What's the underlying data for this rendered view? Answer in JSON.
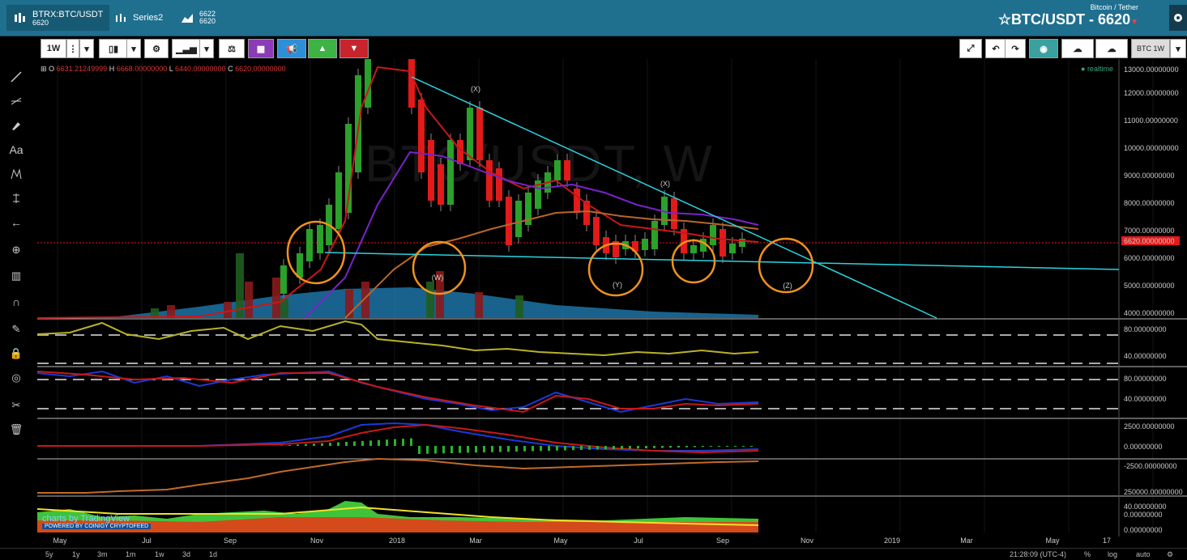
{
  "topbar": {
    "tab1_label": "BTRX:BTC/USDT",
    "tab1_sub": "6620",
    "tab2_label": "Series2",
    "tab3_sub1": "6622",
    "tab3_sub2": "6620",
    "pair_sub": "Bitcoin / Tether",
    "pair_title": "BTC/USDT - 6620"
  },
  "toolbar": {
    "interval": "1W",
    "interval_right": "BTC 1W"
  },
  "ohlc": {
    "o_label": "O",
    "o_value": "6631.21249999",
    "h_label": "H",
    "h_value": "6668.00000000",
    "l_label": "L",
    "l_value": "6440.00000000",
    "c_label": "C",
    "c_value": "6620.00000000"
  },
  "realtime": "realtime",
  "watermark": "BTC/USDT, W",
  "price_axis": [
    "13000.00000000",
    "12000.00000000",
    "11000.00000000",
    "10000.00000000",
    "9000.00000000",
    "8000.00000000",
    "7000.00000000",
    "6620.00000000",
    "6000.00000000",
    "5000.00000000",
    "4000.00000000"
  ],
  "ind1_axis": [
    "80.00000000",
    "40.00000000"
  ],
  "ind2_axis": [
    "80.00000000",
    "40.00000000"
  ],
  "ind3_axis": [
    "2500.00000000",
    "0.00000000",
    "-2500.00000000"
  ],
  "ind4_axis": [
    "250000.00000000",
    "0.00000000"
  ],
  "ind5_axis": [
    "40.00000000",
    "0.00000000"
  ],
  "time_axis": [
    "May",
    "Jul",
    "Sep",
    "Nov",
    "2018",
    "Mar",
    "May",
    "Jul",
    "Sep",
    "Nov",
    "2019",
    "Mar",
    "May",
    "17"
  ],
  "annotations": [
    "(X)",
    "(X)",
    "(W)",
    "(Y)",
    "(Z)"
  ],
  "logo": {
    "line1": "charts by TradingView",
    "line2": "POWERED BY COINIGY CRYPTOFEED"
  },
  "bottom": {
    "ranges": [
      "5y",
      "1y",
      "3m",
      "1m",
      "1w",
      "3d",
      "1d"
    ],
    "time": "21:28:09 (UTC-4)",
    "pct": "%",
    "log": "log",
    "auto": "auto"
  },
  "colors": {
    "topbar": "#1f6f8f",
    "up": "#2aa12a",
    "down": "#e21a1a",
    "trend": "#2ad4e0",
    "circle": "#f0921e",
    "ema_purple": "#7a23c9",
    "ema_orange": "#b8662a"
  }
}
